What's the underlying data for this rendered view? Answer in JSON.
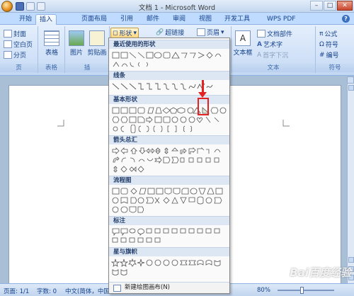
{
  "window": {
    "title": "文档 1 - Microsoft Word"
  },
  "tabs": [
    "开始",
    "插入",
    "页面布局",
    "引用",
    "邮件",
    "审阅",
    "视图",
    "开发工具",
    "WPS PDF"
  ],
  "active_tab": "插入",
  "ribbon": {
    "pages_group": {
      "label": "页",
      "items": [
        "封面",
        "空白页",
        "分页"
      ]
    },
    "table_group": {
      "label": "表格",
      "button": "表格"
    },
    "illustrations_group": {
      "label": "插",
      "picture": "图片",
      "clipart": "剪贴画",
      "shapes": "形状"
    },
    "links": {
      "hyperlink": "超链接"
    },
    "header_footer": {
      "header": "页眉"
    },
    "text_group": {
      "label": "文本",
      "textbox": "文本框",
      "quick_parts": "文档部件",
      "wordart": "艺术字",
      "dropcap": "首字下沉"
    },
    "symbols_group": {
      "label": "符号",
      "formula": "公式",
      "symbol": "符号",
      "number": "编号"
    }
  },
  "shapes_menu": {
    "sections": [
      "最近使用的形状",
      "线条",
      "基本形状",
      "箭头总汇",
      "流程图",
      "标注",
      "星与旗帜"
    ],
    "footer": "新建绘图画布(N)"
  },
  "status": {
    "page": "页面: 1/1",
    "words": "字数: 0",
    "language": "中文(简体，中国",
    "zoom": "80%"
  },
  "watermark": "Bai百度经验",
  "colors": {
    "accent": "#15428b",
    "highlight": "#e52222"
  }
}
